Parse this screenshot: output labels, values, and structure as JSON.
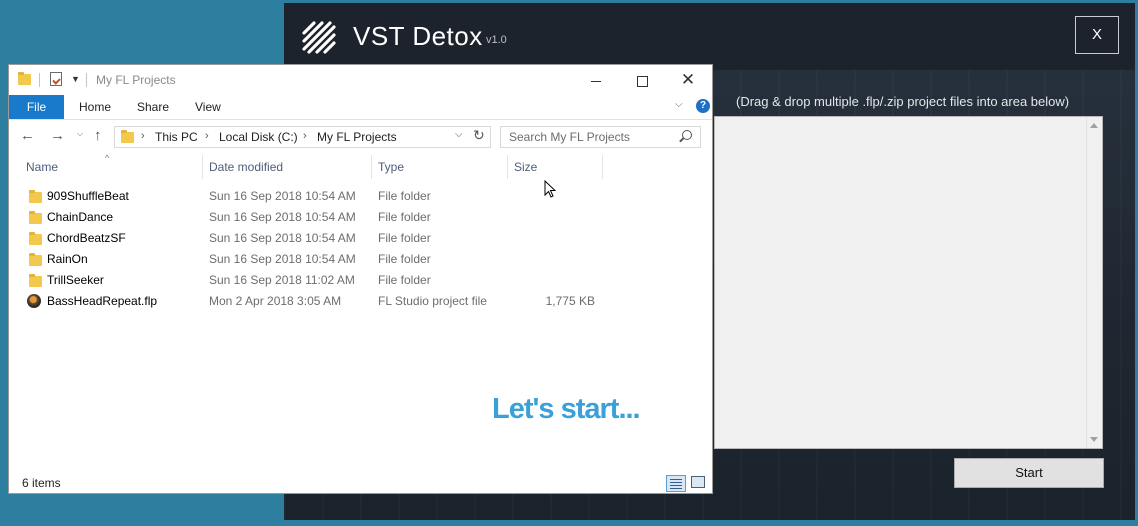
{
  "vst": {
    "title": "VST Detox",
    "version": "v1.0",
    "close_label": "X",
    "hint": "(Drag & drop multiple .flp/.zip project files into area below)",
    "start_label": "Start",
    "overlay_text": "Let's start..."
  },
  "explorer": {
    "window_title": "My FL Projects",
    "close_glyph": "✕",
    "ribbon_tabs": [
      "File",
      "Home",
      "Share",
      "View"
    ],
    "help_glyph": "?",
    "breadcrumbs": [
      "This PC",
      "Local Disk (C:)",
      "My FL Projects"
    ],
    "search_placeholder": "Search My FL Projects",
    "columns": {
      "name": "Name",
      "date": "Date modified",
      "type": "Type",
      "size": "Size"
    },
    "rows": [
      {
        "name": "909ShuffleBeat",
        "date": "Sun 16 Sep 2018 10:54 AM",
        "type": "File folder",
        "size": "",
        "icon": "folder-icon"
      },
      {
        "name": "ChainDance",
        "date": "Sun 16 Sep 2018 10:54 AM",
        "type": "File folder",
        "size": "",
        "icon": "folder-icon"
      },
      {
        "name": "ChordBeatzSF",
        "date": "Sun 16 Sep 2018 10:54 AM",
        "type": "File folder",
        "size": "",
        "icon": "folder-icon"
      },
      {
        "name": "RainOn",
        "date": "Sun 16 Sep 2018 10:54 AM",
        "type": "File folder",
        "size": "",
        "icon": "folder-icon"
      },
      {
        "name": "TrillSeeker",
        "date": "Sun 16 Sep 2018 11:02 AM",
        "type": "File folder",
        "size": "",
        "icon": "folder-icon"
      },
      {
        "name": "BassHeadRepeat.flp",
        "date": "Mon 2 Apr 2018 3:05 AM",
        "type": "FL Studio project file",
        "size": "1,775 KB",
        "icon": "fl-studio-file-icon"
      }
    ],
    "status_count": "6 items"
  },
  "colors": {
    "desktop": "#2e7ea0",
    "vst_background": "#1f2630",
    "accent_file_tab": "#1979ca",
    "overlay_text": "#3aa0d8"
  }
}
